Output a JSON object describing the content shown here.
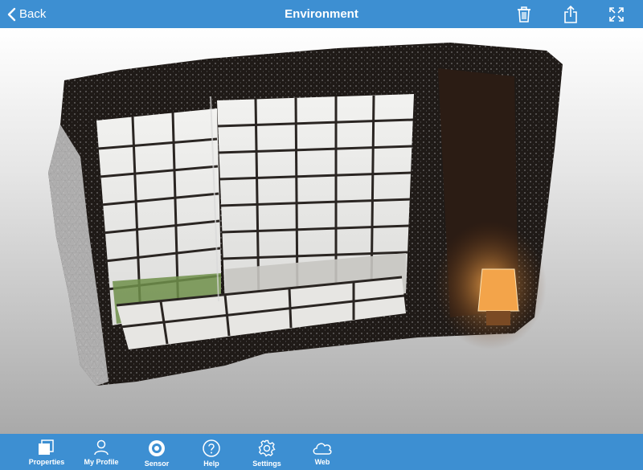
{
  "colors": {
    "bar": "#3d8fd2",
    "bar_text": "#ffffff",
    "viewport_top": "#ffffff",
    "viewport_bottom": "#a9a9a9",
    "lamp": "#f3a44a"
  },
  "navbar": {
    "back_label": "Back",
    "title": "Environment",
    "actions": [
      "trash-icon",
      "share-icon",
      "fullscreen-icon"
    ]
  },
  "viewport": {
    "content": "3d-mesh-scan-window-room"
  },
  "tabbar": {
    "items": [
      {
        "label": "Properties",
        "icon": "properties-icon"
      },
      {
        "label": "My Profile",
        "icon": "profile-icon"
      },
      {
        "label": "Sensor",
        "icon": "sensor-icon"
      },
      {
        "label": "Help",
        "icon": "help-icon"
      },
      {
        "label": "Settings",
        "icon": "settings-icon"
      },
      {
        "label": "Web",
        "icon": "cloud-icon"
      }
    ]
  }
}
